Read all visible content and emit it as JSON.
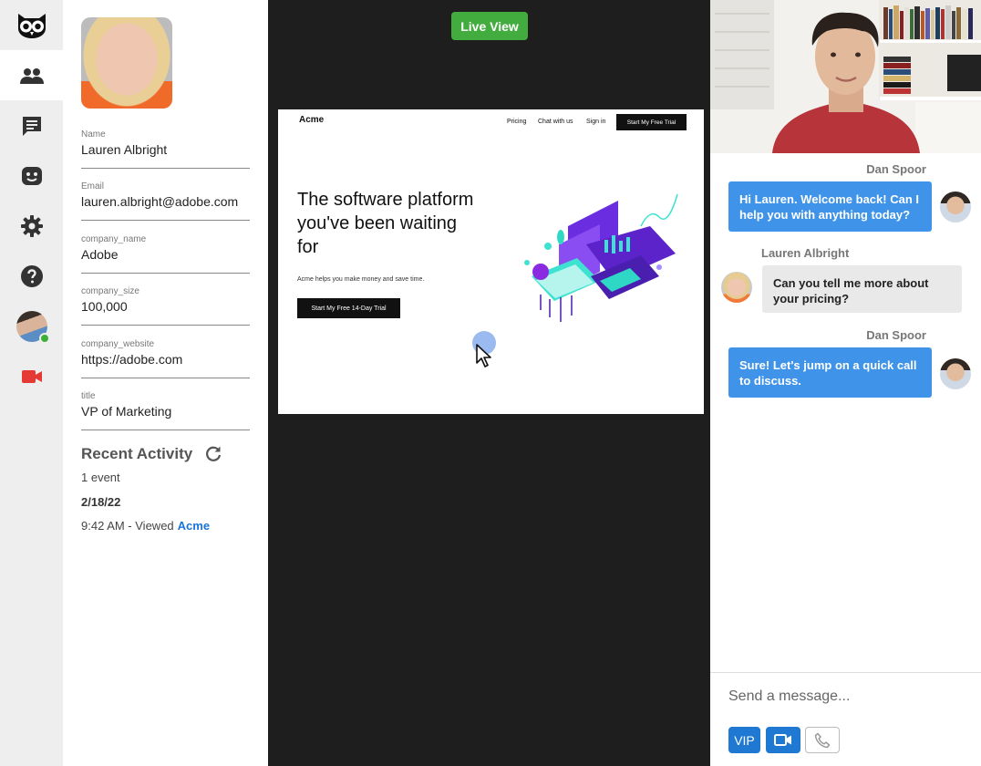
{
  "rail": {
    "items": [
      {
        "icon": "owl-logo-icon"
      },
      {
        "icon": "people-icon",
        "active": true
      },
      {
        "icon": "chat-icon"
      },
      {
        "icon": "bot-icon"
      },
      {
        "icon": "gear-icon"
      },
      {
        "icon": "help-icon"
      },
      {
        "icon": "avatar",
        "status": "online"
      },
      {
        "icon": "video-camera-icon",
        "color": "#e53935"
      }
    ]
  },
  "profile": {
    "fields": [
      {
        "label": "Name",
        "value": "Lauren Albright"
      },
      {
        "label": "Email",
        "value": "lauren.albright@adobe.com"
      },
      {
        "label": "company_name",
        "value": "Adobe"
      },
      {
        "label": "company_size",
        "value": "100,000"
      },
      {
        "label": "company_website",
        "value": "https://adobe.com"
      },
      {
        "label": "title",
        "value": "VP of Marketing"
      }
    ],
    "recent_activity": {
      "title": "Recent Activity",
      "count": "1 event",
      "date": "2/18/22",
      "event_text": "9:42 AM - Viewed",
      "event_link": "Acme"
    }
  },
  "live": {
    "button": "Live View",
    "site": {
      "logo": "Acme",
      "nav": [
        "Pricing",
        "Chat with us",
        "Sign in"
      ],
      "cta": "Start My Free Trial",
      "hero": "The software platform you've been waiting for",
      "sub": "Acme helps you make money and save time.",
      "hero_button": "Start My Free 14-Day Trial"
    }
  },
  "chat": {
    "messages": [
      {
        "sender": "Dan Spoor",
        "text": "Hi Lauren. Welcome back! Can I help you with anything today?",
        "type": "agent"
      },
      {
        "sender": "Lauren Albright",
        "text": "Can you tell me more about your pricing?",
        "type": "visitor"
      },
      {
        "sender": "Dan Spoor",
        "text": "Sure! Let's jump on a quick call to discuss.",
        "type": "agent"
      }
    ],
    "input_placeholder": "Send a message...",
    "controls": {
      "vip": "VIP"
    }
  },
  "colors": {
    "accent": "#3f93e8",
    "live_green": "#43ac3f",
    "online": "#3cb035",
    "video_red": "#e53935"
  }
}
